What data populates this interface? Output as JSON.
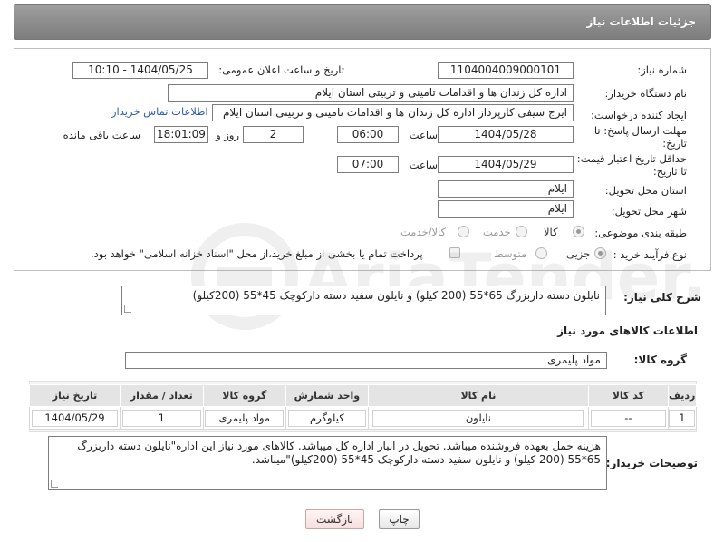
{
  "header": {
    "title": "جزئیات اطلاعات نیاز"
  },
  "fields": {
    "need_number_label": "شماره نیاز:",
    "need_number": "1104004009000101",
    "announce_label": "تاریخ و ساعت اعلان عمومی:",
    "announce_value": "1404/05/25 - 10:10",
    "buyer_org_label": "نام دستگاه خریدار:",
    "buyer_org": "اداره کل زندان ها و اقدامات تامینی و تربیتی استان ایلام",
    "creator_label": "ایجاد کننده درخواست:",
    "creator": "ایرج  سیفی کارپرداز اداره کل زندان ها و اقدامات تامینی و تربیتی استان ایلام",
    "contact_link": "اطلاعات تماس خریدار",
    "reply_deadline_label": "مهلت ارسال پاسخ: تا تاریخ:",
    "reply_date": "1404/05/28",
    "time_label": "ساعت",
    "reply_time": "06:00",
    "days_count": "2",
    "days_label": "روز و",
    "remaining_time": "18:01:09",
    "remaining_label": "ساعت باقی مانده",
    "price_validity_label": "حداقل تاریخ اعتبار قیمت: تا تاریخ:",
    "price_date": "1404/05/29",
    "price_time": "07:00",
    "province_label": "استان محل تحویل:",
    "province": "ایلام",
    "city_label": "شهر محل تحویل:",
    "city": "ایلام",
    "category_label": "طبقه بندی موضوعی:",
    "category_options": [
      "کالا",
      "خدمت",
      "کالا/خدمت"
    ],
    "process_label": "نوع فرآیند خرید :",
    "process_options": [
      "جزیی",
      "متوسط"
    ],
    "payment_note": "پرداخت تمام یا بخشی از مبلغ خرید،از محل \"اسناد خزانه اسلامی\" خواهد بود."
  },
  "description": {
    "label": "شرح کلی نیاز:",
    "text": "نایلون دسته داربزرگ 65*55 (200 کیلو) و نایلون سفید دسته دارکوچک 45*55 (200کیلو)"
  },
  "goods_section": {
    "title": "اطلاعات کالاهای مورد نیاز",
    "group_label": "گروه کالا:",
    "group_value": "مواد پلیمری"
  },
  "table": {
    "headers": [
      "ردیف",
      "کد کالا",
      "نام کالا",
      "واحد شمارش",
      "گروه کالا",
      "تعداد / مقدار",
      "تاریخ نیاز"
    ],
    "rows": [
      [
        "1",
        "--",
        "نایلون",
        "کیلوگرم",
        "مواد پلیمری",
        "1",
        "1404/05/29"
      ]
    ]
  },
  "buyer_notes": {
    "label": "توضیحات خریدار:",
    "text": "هزینه حمل بعهده فروشنده میباشد. تحویل در انبار اداره کل میباشد. کالاهای مورد نیاز این اداره\"نایلون دسته داربزرگ 65*55 (200 کیلو) و نایلون سفید دسته دارکوچک 45*55 (200کیلو)\"میباشد."
  },
  "buttons": {
    "print": "چاپ",
    "back": "بازگشت"
  },
  "watermark": {
    "text": "AriaTender.neT"
  }
}
